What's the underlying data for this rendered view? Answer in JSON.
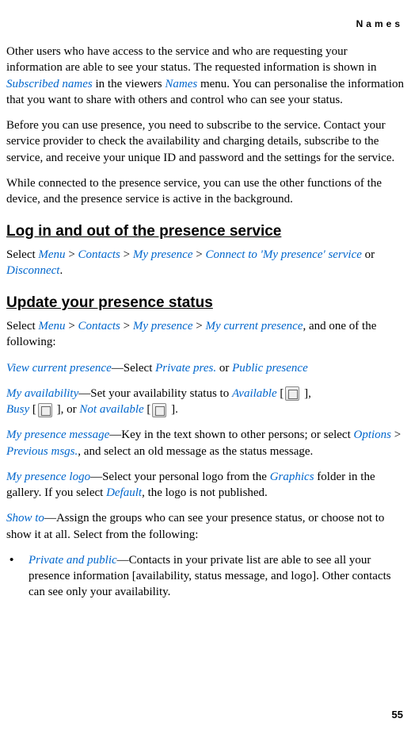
{
  "header": {
    "section": "Names"
  },
  "para1": {
    "t1": "Other users who have access to the service and who are requesting your information are able to see your status. The requested information is shown in ",
    "l1": "Subscribed names",
    "t2": " in the viewers ",
    "l2": "Names",
    "t3": " menu. You can personalise the information that you want to share with others and control who can see your status."
  },
  "para2": "Before you can use presence, you need to subscribe to the service. Contact your service provider to check the availability and charging details, subscribe to the service, and receive your unique ID and password and the settings for the service.",
  "para3": "While connected to the presence service, you can use the other functions of the device, and the presence service is active in the background.",
  "heading1": "Log in and out of the presence service",
  "para4": {
    "t1": "Select ",
    "l1": "Menu",
    "gt1": " > ",
    "l2": "Contacts",
    "gt2": " > ",
    "l3": "My presence",
    "gt3": " > ",
    "l4": "Connect to 'My presence' service",
    "t2": " or ",
    "l5": "Disconnect",
    "t3": "."
  },
  "heading2": "Update your presence status",
  "para5": {
    "t1": "Select ",
    "l1": "Menu",
    "gt1": " > ",
    "l2": "Contacts",
    "gt2": " > ",
    "l3": "My presence",
    "gt3": " > ",
    "l4": "My current presence",
    "t2": ", and one of the following:"
  },
  "para6": {
    "l1": "View current presence",
    "t1": "—Select ",
    "l2": "Private pres.",
    "t2": " or ",
    "l3": "Public presence"
  },
  "para7": {
    "l1": "My availability",
    "t1": "—Set your availability status to ",
    "l2": "Available",
    "t2": " [",
    "t3": " ], ",
    "l3": "Busy",
    "t4": " [",
    "t5": " ], or ",
    "l4": "Not available",
    "t6": " [",
    "t7": " ]."
  },
  "para8": {
    "l1": "My presence message",
    "t1": "—Key in the text shown to other persons; or select ",
    "l2": "Options",
    "gt1": " > ",
    "l3": "Previous msgs.",
    "t2": ", and select an old message as the status message."
  },
  "para9": {
    "l1": "My presence logo",
    "t1": "—Select your personal logo from the ",
    "l2": "Graphics",
    "t2": " folder in the gallery. If you select ",
    "l3": "Default",
    "t3": ", the logo is not published."
  },
  "para10": {
    "l1": "Show to",
    "t1": "—Assign the groups who can see your presence status, or choose not to show it at all. Select from the following:"
  },
  "bullet1": {
    "mark": "•",
    "l1": "Private and public",
    "t1": "—Contacts in your private list are able to see all your presence information [availability, status message, and logo]. Other contacts can see only your availability."
  },
  "pageNumber": "55"
}
